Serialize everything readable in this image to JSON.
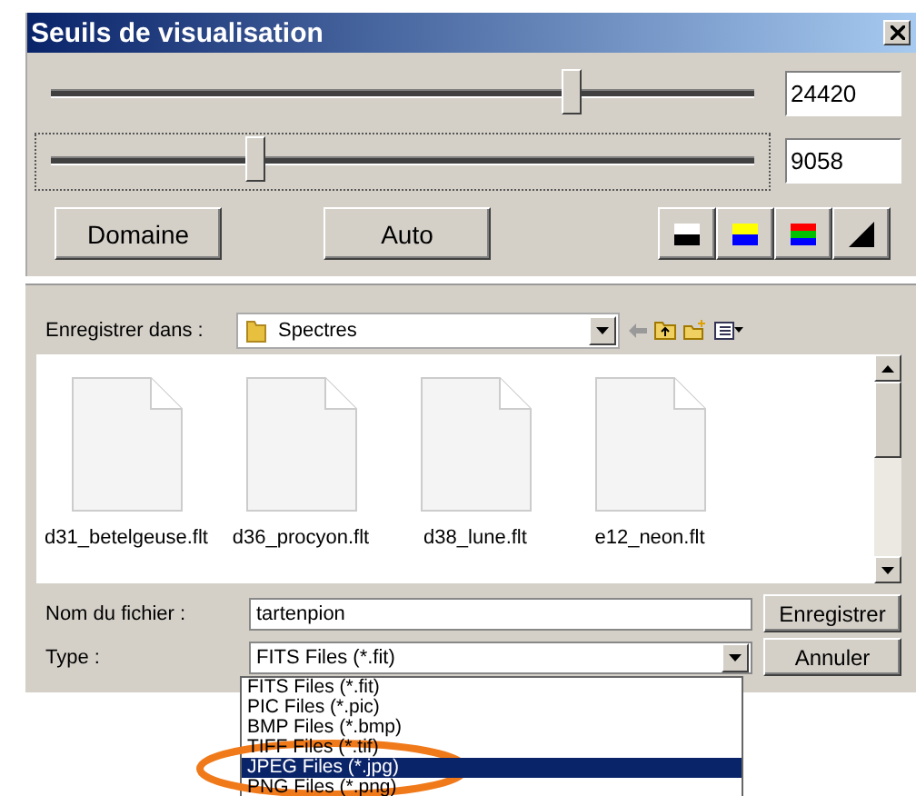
{
  "window": {
    "title": "Seuils de visualisation"
  },
  "sliders": [
    {
      "level": 0.74,
      "value": "24420",
      "focused": false
    },
    {
      "level": 0.29,
      "value": "9058",
      "focused": true
    }
  ],
  "buttons": [
    "Domaine",
    "Auto"
  ],
  "palette_buttons": [
    {
      "kind": "mono"
    },
    {
      "kind": "bicolor"
    },
    {
      "kind": "rgb"
    },
    {
      "kind": "gradient"
    }
  ],
  "save_dialog": {
    "location_label": "Enregistrer dans :",
    "location": "Spectres",
    "files": [
      "d31_betelgeuse.flt",
      "d36_procyon.flt",
      "d38_lune.flt",
      "e12_neon.flt"
    ],
    "filename_label": "Nom du fichier :",
    "filename": "tartenpion",
    "type_label": "Type :",
    "type_value": "FITS Files (*.fit)",
    "save_button": "Enregistrer",
    "cancel_button": "Annuler",
    "type_options": [
      {
        "label": "FITS Files (*.fit)",
        "selected": false
      },
      {
        "label": "PIC Files (*.pic)",
        "selected": false
      },
      {
        "label": "BMP Files (*.bmp)",
        "selected": false
      },
      {
        "label": "TIFF Files (*.tif)",
        "selected": false
      },
      {
        "label": "JPEG Files (*.jpg)",
        "selected": true
      },
      {
        "label": "PNG Files (*.png)",
        "selected": false
      }
    ]
  }
}
